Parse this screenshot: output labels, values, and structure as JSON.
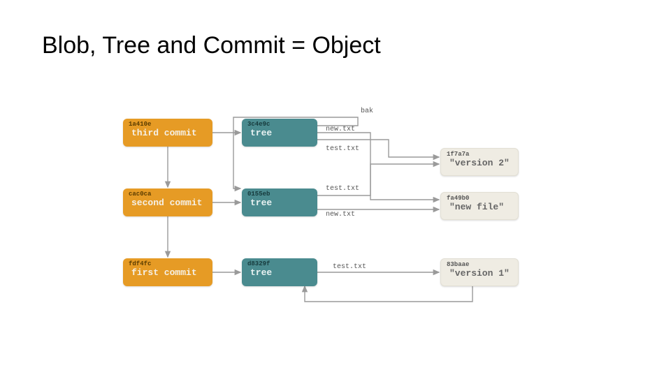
{
  "title": "Blob, Tree and Commit = Object",
  "commits": [
    {
      "hash": "1a410e",
      "label": "third commit"
    },
    {
      "hash": "cac0ca",
      "label": "second commit"
    },
    {
      "hash": "fdf4fc",
      "label": "first commit"
    }
  ],
  "trees": [
    {
      "hash": "3c4e9c",
      "label": "tree"
    },
    {
      "hash": "0155eb",
      "label": "tree"
    },
    {
      "hash": "d8329f",
      "label": "tree"
    }
  ],
  "blobs": [
    {
      "hash": "1f7a7a",
      "label": "\"version 2\""
    },
    {
      "hash": "fa49b0",
      "label": "\"new file\""
    },
    {
      "hash": "83baae",
      "label": "\"version 1\""
    }
  ],
  "edge_labels": {
    "bak": "bak",
    "new_txt": "new.txt",
    "test_txt": "test.txt"
  }
}
